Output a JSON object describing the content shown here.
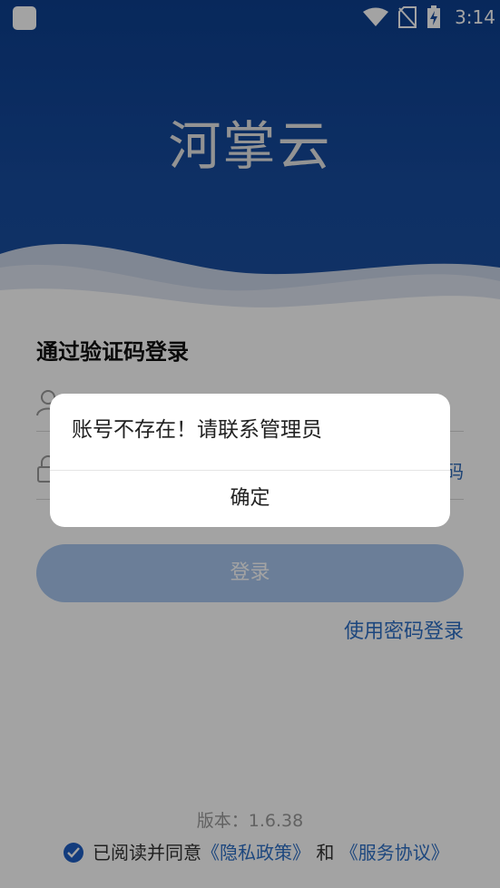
{
  "status_bar": {
    "time": "3:14"
  },
  "app": {
    "title": "河掌云"
  },
  "login": {
    "heading": "通过验证码登录",
    "phone_placeholder": "",
    "code_placeholder": "",
    "get_code_label": "码",
    "submit_label": "登录",
    "password_login_link": "使用密码登录"
  },
  "footer": {
    "version_label": "版本：1.6.38",
    "agree_prefix": "已阅读并同意",
    "privacy_link": "《隐私政策》",
    "and": "和",
    "terms_link": "《服务协议》"
  },
  "dialog": {
    "message": "账号不存在！请联系管理员",
    "confirm_label": "确定"
  },
  "colors": {
    "header_blue": "#0d3f8f",
    "accent": "#2e6fc6",
    "button_disabled": "#a8c6ee"
  }
}
